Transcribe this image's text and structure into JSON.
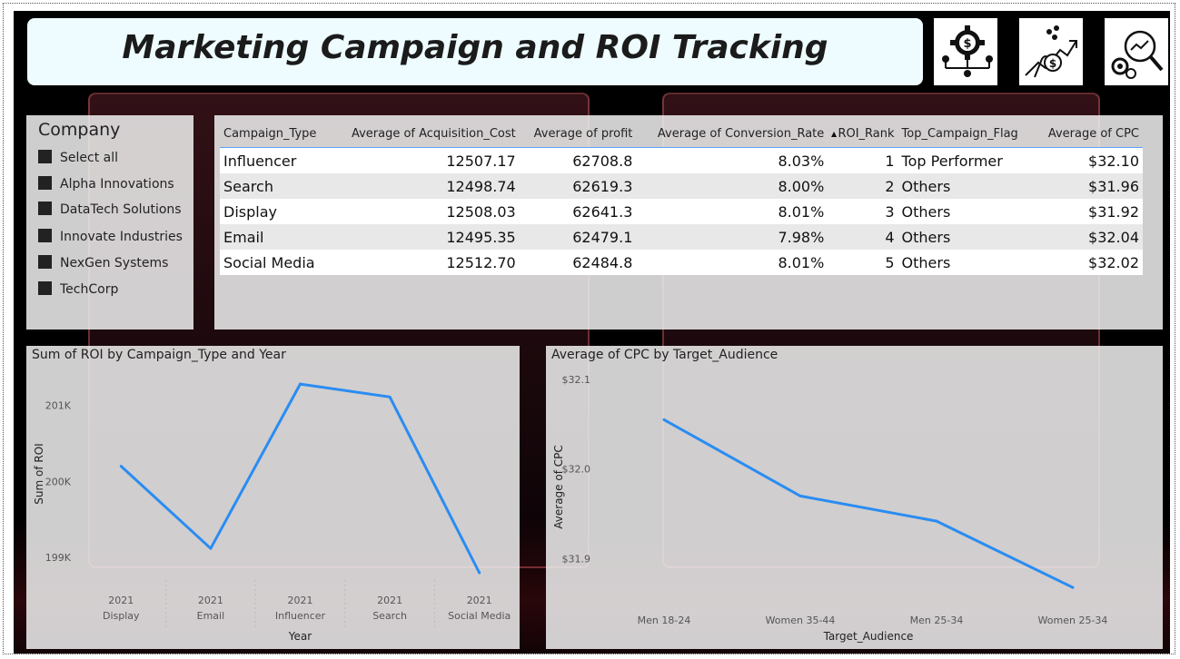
{
  "title": "Marketing Campaign and ROI Tracking",
  "header_icons": [
    "gear-dollar-network-icon",
    "hand-money-growth-icon",
    "analytics-search-gear-icon"
  ],
  "slicer": {
    "title": "Company",
    "items": [
      "Select all",
      "Alpha Innovations",
      "DataTech Solutions",
      "Innovate Industries",
      "NexGen Systems",
      "TechCorp"
    ]
  },
  "table": {
    "headers": [
      "Campaign_Type",
      "Average of Acquisition_Cost",
      "Average of profit",
      "Average of Conversion_Rate",
      "ROI_Rank",
      "Top_Campaign_Flag",
      "Average of CPC"
    ],
    "sorted_column": "ROI_Rank",
    "rows": [
      [
        "Influencer",
        "12507.17",
        "62708.8",
        "8.03%",
        "1",
        "Top Performer",
        "$32.10"
      ],
      [
        "Search",
        "12498.74",
        "62619.3",
        "8.00%",
        "2",
        "Others",
        "$31.96"
      ],
      [
        "Display",
        "12508.03",
        "62641.3",
        "8.01%",
        "3",
        "Others",
        "$31.92"
      ],
      [
        "Email",
        "12495.35",
        "62479.1",
        "7.98%",
        "4",
        "Others",
        "$32.04"
      ],
      [
        "Social Media",
        "12512.70",
        "62484.8",
        "8.01%",
        "5",
        "Others",
        "$32.02"
      ]
    ]
  },
  "roi_chart": {
    "title": "Sum of ROI by Campaign_Type and Year",
    "xlabel": "Year",
    "ylabel": "Sum of ROI",
    "y_ticks": [
      "201K",
      "200K",
      "199K"
    ]
  },
  "cpc_chart": {
    "title": "Average of CPC by Target_Audience",
    "xlabel": "Target_Audience",
    "ylabel": "Average of CPC",
    "y_ticks": [
      "$32.1",
      "$32.0",
      "$31.9"
    ]
  },
  "chart_data": [
    {
      "type": "line",
      "title": "Sum of ROI by Campaign_Type and Year",
      "xlabel": "Year",
      "ylabel": "Sum of ROI",
      "categories": [
        {
          "year": "2021",
          "campaign": "Display"
        },
        {
          "year": "2021",
          "campaign": "Email"
        },
        {
          "year": "2021",
          "campaign": "Influencer"
        },
        {
          "year": "2021",
          "campaign": "Search"
        },
        {
          "year": "2021",
          "campaign": "Social Media"
        }
      ],
      "values": [
        200200,
        199120,
        201280,
        201110,
        198800
      ],
      "ylim": [
        198800,
        201400
      ],
      "y_tick_values": [
        201000,
        200000,
        199000
      ],
      "color": "#2a8cf2"
    },
    {
      "type": "line",
      "title": "Average of CPC by Target_Audience",
      "xlabel": "Target_Audience",
      "ylabel": "Average of CPC",
      "categories": [
        "Men 18-24",
        "Women 35-44",
        "Men 25-34",
        "Women 25-34"
      ],
      "values": [
        32.055,
        31.97,
        31.942,
        31.868
      ],
      "ylim": [
        31.85,
        32.11
      ],
      "y_tick_values": [
        32.1,
        32.0,
        31.9
      ],
      "color": "#2a8cf2"
    }
  ]
}
